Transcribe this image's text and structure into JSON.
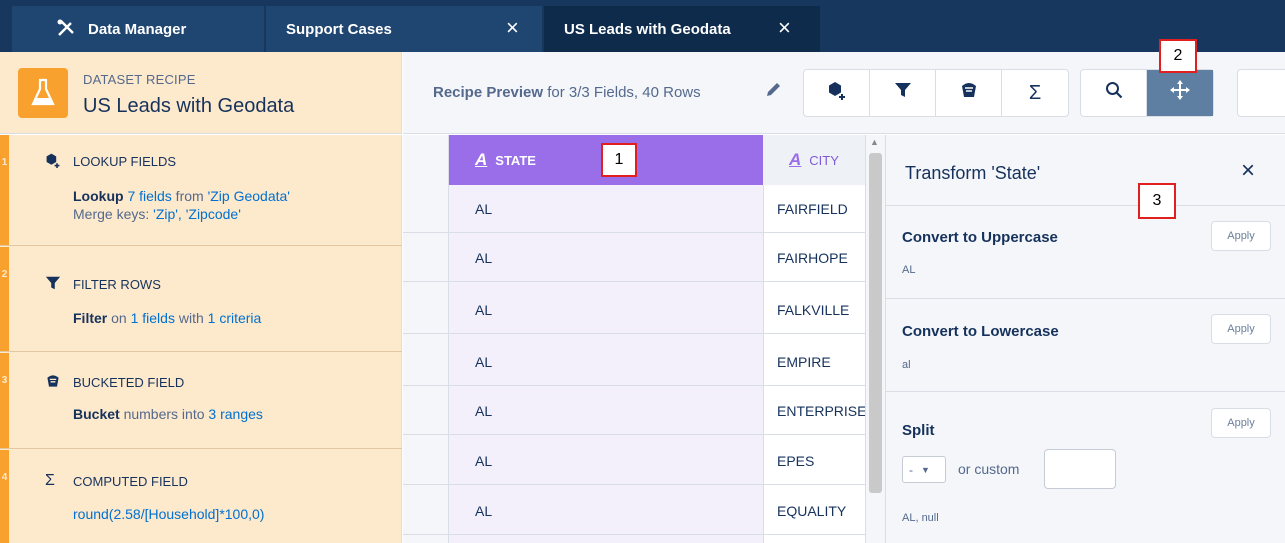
{
  "tabs": {
    "app_label": "Data Manager",
    "app_icon": "tools-icon",
    "tab1_label": "Support Cases",
    "tab2_label": "US Leads with Geodata",
    "close_glyph": "×"
  },
  "recipe": {
    "kind": "DATASET RECIPE",
    "name": "US Leads with Geodata"
  },
  "toolbar": {
    "preview_bold": "Recipe Preview",
    "preview_rest": " for 3/3 Fields, 40 Rows",
    "buttons": [
      "lookup-icon",
      "filter-icon",
      "bucket-icon",
      "sigma-icon",
      "search-icon",
      "move-icon"
    ],
    "active_button": "move-icon"
  },
  "steps": [
    {
      "num": "1",
      "title": "LOOKUP FIELDS",
      "line1_bold": "Lookup",
      "line1_link1": "7 fields",
      "line1_mid": " from ",
      "line1_link2": "'Zip Geodata'",
      "line2_plain": "Merge keys: ",
      "line2_link": "'Zip', 'Zipcode'"
    },
    {
      "num": "2",
      "title": "FILTER ROWS",
      "bold": "Filter",
      "mid1": " on ",
      "link1": "1 fields",
      "mid2": " with ",
      "link2": "1 criteria"
    },
    {
      "num": "3",
      "title": "BUCKETED FIELD",
      "bold": "Bucket",
      "mid1": " numbers into ",
      "link1": "3 ranges"
    },
    {
      "num": "4",
      "title": "COMPUTED FIELD",
      "formula": "round(2.58/[Household]*100,0)"
    }
  ],
  "grid": {
    "col_state": "STATE",
    "col_city": "CITY",
    "rows": [
      {
        "state": "AL",
        "city": "FAIRFIELD"
      },
      {
        "state": "AL",
        "city": "FAIRHOPE"
      },
      {
        "state": "AL",
        "city": "FALKVILLE"
      },
      {
        "state": "AL",
        "city": "EMPIRE"
      },
      {
        "state": "AL",
        "city": "ENTERPRISE"
      },
      {
        "state": "AL",
        "city": "EPES"
      },
      {
        "state": "AL",
        "city": "EQUALITY"
      }
    ]
  },
  "transform_panel": {
    "title": "Transform 'State'",
    "upper_label": "Convert to Uppercase",
    "upper_example": "AL",
    "lower_label": "Convert to Lowercase",
    "lower_example": "al",
    "split_label": "Split",
    "split_selected": "-",
    "or_custom": "or custom",
    "split_example": "AL, null",
    "apply_label": "Apply"
  },
  "callouts": [
    "1",
    "2",
    "3"
  ]
}
